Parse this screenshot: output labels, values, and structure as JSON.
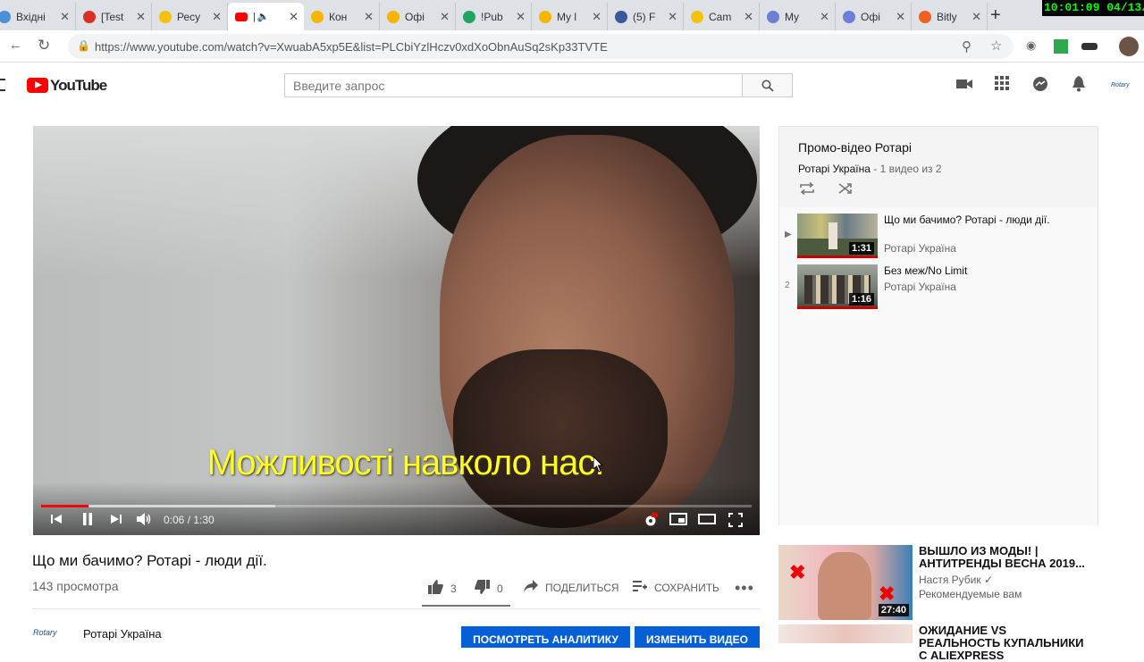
{
  "browser": {
    "tabs": [
      {
        "title": "Вхідні",
        "icon": "inbox-icon",
        "color": "#4a90d9"
      },
      {
        "title": "[Test",
        "icon": "gmail-icon",
        "color": "#d93025"
      },
      {
        "title": "Ресу",
        "icon": "coin-icon",
        "color": "#f4c20d"
      },
      {
        "title": "",
        "icon": "youtube-icon",
        "color": "#ff0000"
      },
      {
        "title": "Кон",
        "icon": "rotary-icon",
        "color": "#f7b500"
      },
      {
        "title": "Офі",
        "icon": "rotary-icon",
        "color": "#f7b500"
      },
      {
        "title": "!Pub",
        "icon": "drive-icon",
        "color": "#1fa463"
      },
      {
        "title": "My l",
        "icon": "rotary-icon",
        "color": "#f7b500"
      },
      {
        "title": "(5) F",
        "icon": "facebook-icon",
        "color": "#3b5998"
      },
      {
        "title": "Cam",
        "icon": "coin-icon",
        "color": "#f4c20d"
      },
      {
        "title": "My",
        "icon": "globe-icon",
        "color": "#6b7fd7"
      },
      {
        "title": "Офі",
        "icon": "globe-icon",
        "color": "#6b7fd7"
      },
      {
        "title": "Bitly",
        "icon": "bitly-icon",
        "color": "#ee6123"
      }
    ],
    "clock": "10:01:09  04/13/2",
    "url": "https://www.youtube.com/watch?v=XwuabA5xp5E&list=PLCbiYzlHczv0xdXoObnAuSq2sKp33TVTE"
  },
  "youtube": {
    "logo_text": "YouTube",
    "search_placeholder": "Введите запрос",
    "account_label": "Rotary"
  },
  "player": {
    "subtitle": "Можливості навколо нас.",
    "time": "0:06 / 1:30",
    "progress_played": 0.067,
    "progress_buffered": 0.33
  },
  "video": {
    "title": "Що ми бачимо? Ротарі - люди дії.",
    "views": "143 просмотра",
    "likes": "3",
    "dislikes": "0",
    "share": "ПОДЕЛИТЬСЯ",
    "save": "СОХРАНИТЬ",
    "channel_logo": "Rotary",
    "channel_name": "Ротарі Україна",
    "analytics_btn": "ПОСМОТРЕТЬ АНАЛИТИКУ",
    "edit_btn": "ИЗМЕНИТЬ ВИДЕО"
  },
  "playlist": {
    "title": "Промо-відео Ротарі",
    "owner": "Ротарі Україна",
    "position": " - 1 видео из 2",
    "items": [
      {
        "index": "▶",
        "title": "Що ми бачимо? Ротарі - люди дії.",
        "channel": "Ротарі Україна",
        "duration": "1:31"
      },
      {
        "index": "2",
        "title": "Без меж/No Limit",
        "channel": "Ротарі Україна",
        "duration": "1:16"
      }
    ]
  },
  "recommended": [
    {
      "title": "ВЫШЛО ИЗ МОДЫ! | АНТИТРЕНДЫ ВЕСНА 2019...",
      "channel": "Настя Рубик ✓",
      "meta": "Рекомендуемые вам",
      "duration": "27:40"
    },
    {
      "title": "ОЖИДАНИЕ VS РЕАЛЬНОСТЬ КУПАЛЬНИКИ С ALIEXPRESS",
      "channel": "",
      "meta": "",
      "duration": ""
    }
  ]
}
